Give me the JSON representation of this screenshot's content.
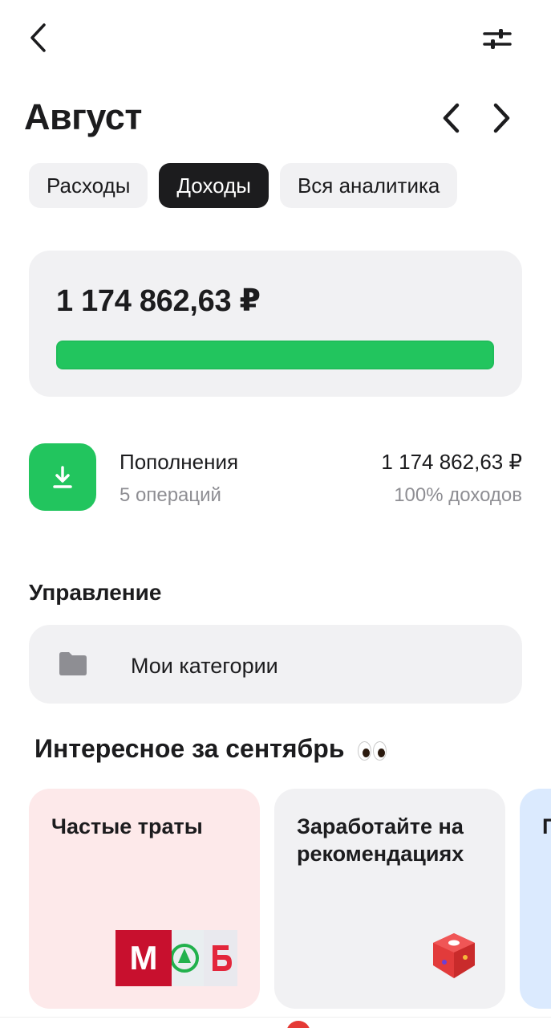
{
  "header": {
    "back_icon": "chevron-left-icon",
    "filter_icon": "sliders-icon"
  },
  "title": "Август",
  "tabs": [
    {
      "label": "Расходы",
      "active": false
    },
    {
      "label": "Доходы",
      "active": true
    },
    {
      "label": "Вся аналитика",
      "active": false
    }
  ],
  "summary": {
    "amount": "1 174 862,63 ₽",
    "progress_percent": 100,
    "bar_color": "#22c55e"
  },
  "category": {
    "icon": "download-icon",
    "name": "Пополнения",
    "count": "5 операций",
    "amount": "1 174 862,63 ₽",
    "share": "100% доходов",
    "color": "#22c55e"
  },
  "management": {
    "title": "Управление",
    "item_icon": "folder-icon",
    "item_label": "Мои категории"
  },
  "interesting": {
    "title": "Интересное за сентябрь",
    "emoji": "eyes",
    "cards": [
      {
        "title": "Частые траты",
        "bg": "#fde9ea",
        "logo_m": "М"
      },
      {
        "title": "Заработайте на рекомендациях",
        "bg": "#f1f1f3"
      },
      {
        "title": "П м",
        "bg": "#dbeafe"
      }
    ]
  }
}
